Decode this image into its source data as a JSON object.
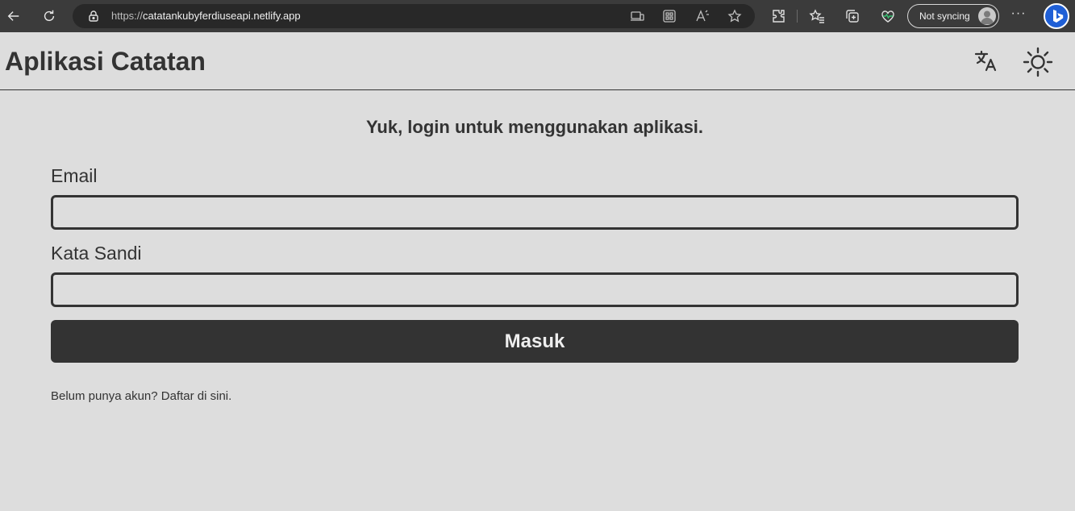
{
  "browser": {
    "url_scheme": "https://",
    "url_host": "catatankubyferdiuseapi.netlify.app",
    "sync_label": "Not syncing",
    "more_label": "···",
    "icons": [
      "back-arrow-icon",
      "reload-icon",
      "lock-icon",
      "app-available-icon",
      "apps-grid-icon",
      "read-aloud-icon",
      "favorite-star-icon",
      "extensions-icon",
      "favorites-icon",
      "collections-icon",
      "performance-icon",
      "profile-avatar-icon",
      "bing-icon"
    ]
  },
  "app": {
    "title": "Aplikasi Catatan",
    "icons": [
      "translate-icon",
      "sun-icon"
    ]
  },
  "login": {
    "heading": "Yuk, login untuk menggunakan aplikasi.",
    "email_label": "Email",
    "email_value": "",
    "password_label": "Kata Sandi",
    "password_value": "",
    "submit_label": "Masuk",
    "register_text": "Belum punya akun? ",
    "register_link": "Daftar di sini."
  },
  "colors": {
    "page_background": "#dddddd",
    "text": "#333333",
    "button_background": "#333333",
    "button_text": "#eeeeee",
    "chrome_background": "#3b3b3b"
  }
}
